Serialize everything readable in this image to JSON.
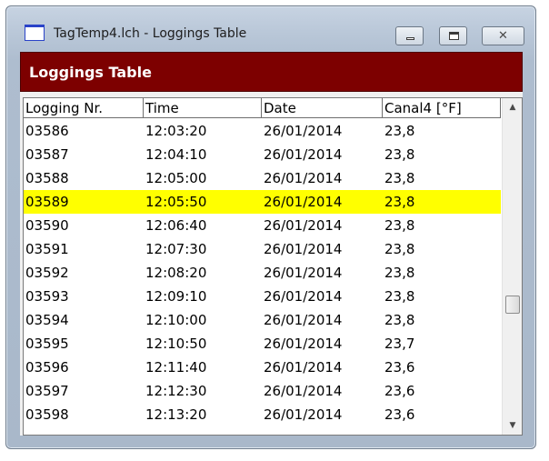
{
  "window": {
    "title": "TagTemp4.lch - Loggings Table",
    "close_symbol": "✕"
  },
  "header": {
    "title": "Loggings Table"
  },
  "table": {
    "columns": [
      "Logging Nr.",
      "Time",
      "Date",
      "Canal4 [°F]"
    ],
    "selected_row": 3,
    "rows": [
      [
        "03586",
        "12:03:20",
        "26/01/2014",
        "23,8"
      ],
      [
        "03587",
        "12:04:10",
        "26/01/2014",
        "23,8"
      ],
      [
        "03588",
        "12:05:00",
        "26/01/2014",
        "23,8"
      ],
      [
        "03589",
        "12:05:50",
        "26/01/2014",
        "23,8"
      ],
      [
        "03590",
        "12:06:40",
        "26/01/2014",
        "23,8"
      ],
      [
        "03591",
        "12:07:30",
        "26/01/2014",
        "23,8"
      ],
      [
        "03592",
        "12:08:20",
        "26/01/2014",
        "23,8"
      ],
      [
        "03593",
        "12:09:10",
        "26/01/2014",
        "23,8"
      ],
      [
        "03594",
        "12:10:00",
        "26/01/2014",
        "23,8"
      ],
      [
        "03595",
        "12:10:50",
        "26/01/2014",
        "23,7"
      ],
      [
        "03596",
        "12:11:40",
        "26/01/2014",
        "23,6"
      ],
      [
        "03597",
        "12:12:30",
        "26/01/2014",
        "23,6"
      ],
      [
        "03598",
        "12:13:20",
        "26/01/2014",
        "23,6"
      ]
    ]
  },
  "scrollbar": {
    "up_icon": "▲",
    "down_icon": "▼"
  },
  "colors": {
    "header_band": "#7d0000",
    "selection": "#ffff00"
  }
}
